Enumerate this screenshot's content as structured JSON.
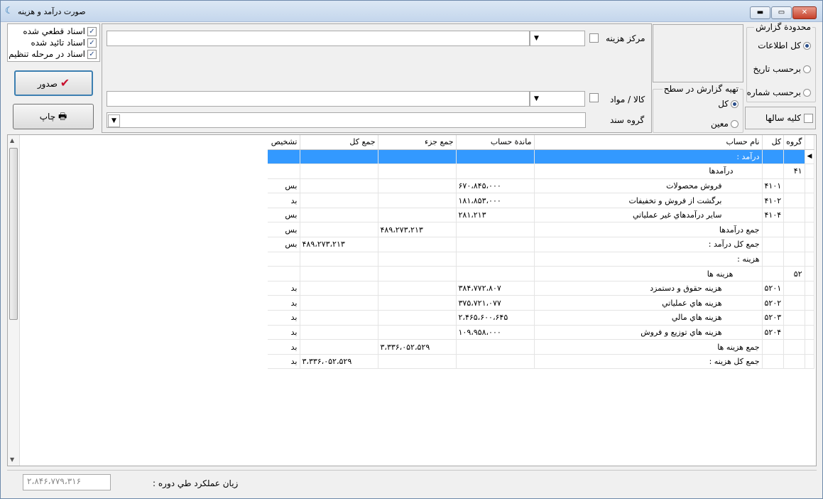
{
  "window": {
    "title": "صورت درآمد و هزينه",
    "minimize_label": "▬",
    "maximize_label": "▭",
    "close_label": "✕"
  },
  "document_status": {
    "items": [
      {
        "label": "اسناد قطعي شده",
        "checked": true
      },
      {
        "label": "اسناد تائيد شده",
        "checked": true
      },
      {
        "label": "اسناد در مرحله تنظيم",
        "checked": true
      }
    ]
  },
  "buttons": {
    "issue_label": "صدور",
    "print_label": "چاپ"
  },
  "filters": {
    "cost_center_label": "مركز هزينه",
    "goods_label": "كالا / مواد",
    "doc_group_label": "گروه سند"
  },
  "report_range": {
    "title": "محدودة گزارش",
    "options": [
      {
        "label": "كل اطلاعات",
        "selected": true
      },
      {
        "label": "برحسب تاريخ",
        "selected": false
      },
      {
        "label": "برحسب شماره",
        "selected": false
      }
    ]
  },
  "report_level": {
    "title": "تهيه گزارش در سطح",
    "options": [
      {
        "label": "كل",
        "selected": true
      },
      {
        "label": "معين",
        "selected": false
      }
    ]
  },
  "all_years_label": "كليه سالها",
  "grid": {
    "headers": [
      "گروه",
      "كل",
      "نام حساب",
      "ماندة حساب",
      "جمع جزء",
      "جمع كل",
      "تشخيص"
    ],
    "rows": [
      {
        "group": "",
        "ledger": "",
        "name": "درآمد :",
        "balance": "",
        "subtotal": "",
        "total": "",
        "status": ""
      },
      {
        "group": "۴۱",
        "ledger": "",
        "name": "درآمدها",
        "balance": "",
        "subtotal": "",
        "total": "",
        "status": ""
      },
      {
        "group": "",
        "ledger": "۴۱۰۱",
        "name": "فروش محصولات",
        "balance": "۶۷۰،۸۴۵،۰۰۰",
        "subtotal": "",
        "total": "",
        "status": "بس"
      },
      {
        "group": "",
        "ledger": "۴۱۰۲",
        "name": "برگشت از فروش و تخفيفات",
        "balance": "۱۸۱،۸۵۳،۰۰۰",
        "subtotal": "",
        "total": "",
        "status": "بد"
      },
      {
        "group": "",
        "ledger": "۴۱۰۴",
        "name": "ساير درآمدهاي غير عملياتي",
        "balance": "۲۸۱،۲۱۳",
        "subtotal": "",
        "total": "",
        "status": "بس"
      },
      {
        "group": "",
        "ledger": "",
        "name": "جمع درآمدها",
        "balance": "",
        "subtotal": "۴۸۹،۲۷۳،۲۱۳",
        "total": "",
        "status": "بس"
      },
      {
        "group": "",
        "ledger": "",
        "name": "جمع كل درآمد :",
        "balance": "",
        "subtotal": "",
        "total": "۴۸۹،۲۷۳،۲۱۳",
        "status": "بس"
      },
      {
        "group": "",
        "ledger": "",
        "name": "هزينه :",
        "balance": "",
        "subtotal": "",
        "total": "",
        "status": ""
      },
      {
        "group": "۵۲",
        "ledger": "",
        "name": "هزينه ها",
        "balance": "",
        "subtotal": "",
        "total": "",
        "status": ""
      },
      {
        "group": "",
        "ledger": "۵۲۰۱",
        "name": "هزينه حقوق و دستمزد",
        "balance": "۳۸۴،۷۷۲،۸۰۷",
        "subtotal": "",
        "total": "",
        "status": "بد"
      },
      {
        "group": "",
        "ledger": "۵۲۰۲",
        "name": "هزينه هاي عملياتي",
        "balance": "۳۷۵،۷۲۱،۰۷۷",
        "subtotal": "",
        "total": "",
        "status": "بد"
      },
      {
        "group": "",
        "ledger": "۵۲۰۳",
        "name": "هزينه هاي مالي",
        "balance": "۲،۴۶۵،۶۰۰،۶۴۵",
        "subtotal": "",
        "total": "",
        "status": "بد"
      },
      {
        "group": "",
        "ledger": "۵۲۰۴",
        "name": "هزينه هاي توزيع و فروش",
        "balance": "۱۰۹،۹۵۸،۰۰۰",
        "subtotal": "",
        "total": "",
        "status": "بد"
      },
      {
        "group": "",
        "ledger": "",
        "name": "جمع هزينه ها",
        "balance": "",
        "subtotal": "۳،۳۳۶،۰۵۲،۵۲۹",
        "total": "",
        "status": "بد"
      },
      {
        "group": "",
        "ledger": "",
        "name": "جمع كل هزينه :",
        "balance": "",
        "subtotal": "",
        "total": "۳،۳۳۶،۰۵۲،۵۲۹",
        "status": "بد"
      }
    ]
  },
  "footer": {
    "result_label": "زيان عملكرد طي دوره :",
    "result_value": "۲،۸۴۶،۷۷۹،۳۱۶"
  }
}
